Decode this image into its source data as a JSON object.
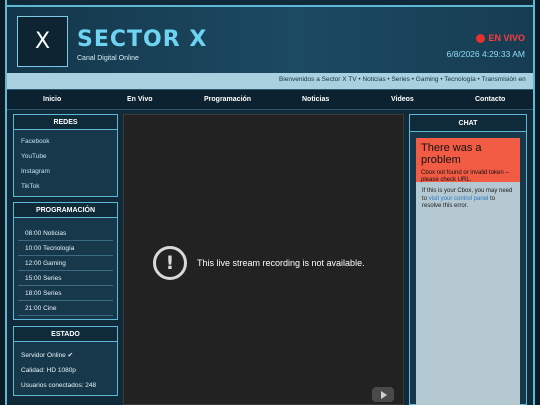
{
  "header": {
    "logo_glyph": "X",
    "title": "SECTOR X",
    "subtitle": "Canal Digital Online",
    "live_label": "EN VIVO",
    "datetime": "6/8/2026 4:29:33 AM",
    "live_color": "#e8302c",
    "accent_color": "#6fd3f2"
  },
  "ticker": {
    "text": "Bienvenidos a Sector X TV • Noticias • Series • Gaming • Tecnología • Transmisión en"
  },
  "nav": {
    "items": [
      "Inicio",
      "En Vivo",
      "Programación",
      "Noticias",
      "Videos",
      "Contacto"
    ]
  },
  "sidebar": {
    "redes": {
      "title": "REDES",
      "items": [
        "Facebook",
        "YouTube",
        "Instagram",
        "TikTok"
      ]
    },
    "programacion": {
      "title": "PROGRAMACIÓN",
      "items": [
        "08:00 Noticias",
        "10:00 Tecnología",
        "12:00 Gaming",
        "15:00 Series",
        "18:00 Series",
        "21:00 Cine"
      ]
    },
    "estado": {
      "title": "ESTADO",
      "items": [
        "Servidor Online ✔",
        "Calidad: HD 1080p",
        "Usuarios conectados: 248"
      ]
    }
  },
  "video": {
    "icon": "warning-circle-icon",
    "message": "This live stream recording is not available."
  },
  "chat": {
    "title": "CHAT",
    "error_title": "There was a problem",
    "error_desc": "Cbox not found or invalid token – please check URL.",
    "info_before": "If this is your Cbox, you may need to ",
    "info_link": "visit your control panel",
    "info_after": " to resolve this error."
  }
}
